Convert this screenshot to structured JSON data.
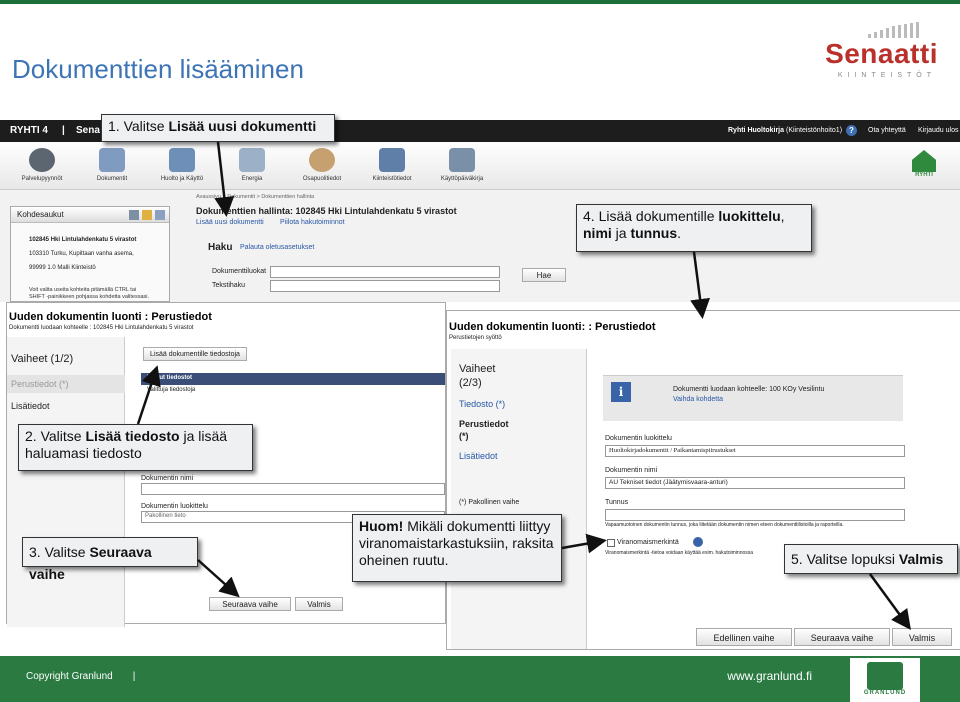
{
  "slide": {
    "title": "Dokumenttien lisääminen",
    "logo_name": "Senaatti",
    "logo_sub": "KIINTEISTÖT"
  },
  "app": {
    "brand": "RYHTI 4",
    "brand_sep": "|",
    "brand_trunc": "Sena",
    "user": "Ryhti Huoltokirja",
    "user_role": "(Kiinteistönhoito1)",
    "help": "?",
    "contact": "Ota yhteyttä",
    "logout": "Kirjaudu ulos",
    "toolbar": [
      "Palvelupyynnöt",
      "Dokumentit",
      "Huolto ja Käyttö",
      "Energia",
      "Osapuolitiedot",
      "Kiinteistötiedot",
      "Käyttöpäiväkirja"
    ],
    "ryhti_label": "RYHTI"
  },
  "hallinta": {
    "breadcrumb": "Avaussivu > Dokumentit > Dokumenttien hallinta",
    "title": "Dokumenttien hallinta: 102845 Hki Lintulahdenkatu 5 virastot",
    "add_link": "Lisää uusi dokumentti",
    "hide_link": "Piilota hakutoiminnot",
    "search_title": "Haku",
    "reset_link": "Palauta oletusasetukset",
    "class_label": "Dokumenttiluokat",
    "text_label": "Tekstihaku",
    "search_btn": "Hae"
  },
  "tree": {
    "title": "Kohdesaukut",
    "items": [
      "102845 Hki Lintulahdenkatu 5 virastot",
      "103310 Turku, Kupittaan vanha asema,",
      "99999 1.0 Malli Kiinteistö"
    ],
    "hint1": "Voit valita useita kohteita pitämällä CTRL tai",
    "hint2": "SHIFT -painikkeen pohjassa kohdetta valitessasi."
  },
  "step1": {
    "title": "Uuden dokumentin luonti : Perustiedot",
    "sub": "Dokumentti luodaan kohteelle : 102845 Hki Lintulahdenkatu 5 virastot",
    "steps_title": "Vaiheet (1/2)",
    "step_basic": "Perustiedot (*)",
    "step_extra": "Lisätiedot",
    "add_file_btn": "Lisää dokumentille tiedostoja",
    "file_row1": "Valitut tiedostot",
    "file_row2": "Valittuja tiedostoja",
    "doc_name_label": "Dokumentin nimi",
    "doc_class_label": "Dokumentin luokittelu",
    "doc_class_value": "Pakollinen tieto",
    "next_btn": "Seuraava vaihe",
    "finish_btn": "Valmis"
  },
  "step2": {
    "title": "Uuden dokumentin luonti: : Perustiedot",
    "sub": "Perustietojen syöttö",
    "steps_title": "Vaiheet",
    "steps_count": "(2/3)",
    "step_file": "Tiedosto (*)",
    "step_basic": "Perustiedot",
    "step_basic_req": "(*)",
    "step_extra": "Lisätiedot",
    "req_note": "(*) Pakollinen vaihe",
    "info_text": "Dokumentti luodaan kohteelle: 100 KOy Vesilintu",
    "change_link": "Vaihda kohdetta",
    "class_label": "Dokumentin luokittelu",
    "class_value": "Huoltokirjadokumentit / Paikantamispiirustukset",
    "name_label": "Dokumentin nimi",
    "name_value": "AU Tekniset tiedot (Jäätymisvaara-anturi)",
    "id_label": "Tunnus",
    "id_note": "Vapaamuotoinen dokumentin tunnus, joka liitetään dokumentin nimen eteen dokumenttilistoilla ja raporteilla.",
    "official_label": "Viranomaismerkintä",
    "official_note": "Viranomaismerkintä -tietoa voidaan käyttää esim. hakutoiminnossa",
    "prev_btn": "Edellinen vaihe",
    "next_btn": "Seuraava vaihe",
    "finish_btn": "Valmis"
  },
  "callouts": {
    "c1_pre": "1. Valitse ",
    "c1_bold": "Lisää uusi dokumentti",
    "c2_pre": "2. Valitse ",
    "c2_bold": "Lisää tiedosto",
    "c2_post": " ja lisää",
    "c2_line2": "haluamasi tiedosto",
    "c3_pre": "3. Valitse ",
    "c3_bold": "Seuraava vaihe",
    "c4_pre": "4. Lisää dokumentille ",
    "c4_bold1": "luokittelu",
    "c4_mid": ",",
    "c4_bold2": "nimi",
    "c4_mid2": " ja ",
    "c4_bold3": "tunnus",
    "c4_end": ".",
    "c5_pre": "5. Valitse lopuksi ",
    "c5_bold": "Valmis",
    "huom_bold": "Huom!",
    "huom_text": " Mikäli dokumentti liittyy",
    "huom_line2": "viranomaistarkastuksiin, raksita",
    "huom_line3": "oheinen ruutu."
  },
  "footer": {
    "copyright": "Copyright Granlund",
    "sep": "|",
    "web": "www.granlund.fi",
    "logo_label": "GRANLUND"
  }
}
